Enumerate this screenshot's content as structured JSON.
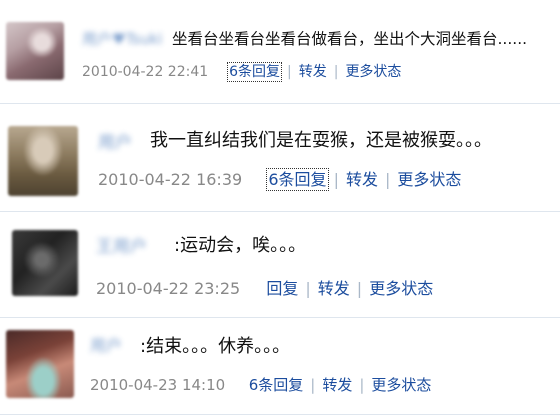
{
  "posts": [
    {
      "name": "用户♥Tsuki",
      "separator": ":",
      "text": "坐看台坐看台坐看台做看台，坐出个大洞坐看台......",
      "time": "2010-04-22 22:41",
      "reply": "6条回复",
      "forward": "转发",
      "more": "更多状态"
    },
    {
      "name": "用户",
      "separator": ":",
      "text": "我一直纠结我们是在耍猴，还是被猴耍。。。",
      "time": "2010-04-22 16:39",
      "reply": "6条回复",
      "forward": "转发",
      "more": "更多状态"
    },
    {
      "name": "王用户",
      "separator": ":",
      "text": "运动会，唉。。。",
      "time": "2010-04-22 23:25",
      "reply": "回复",
      "forward": "转发",
      "more": "更多状态"
    },
    {
      "name": "用户",
      "separator": ":",
      "text": "结束。。。休养。。。",
      "time": "2010-04-23 14:10",
      "reply": "6条回复",
      "forward": "转发",
      "more": "更多状态"
    }
  ],
  "colors": {
    "link": "#1c4d9e",
    "name": "#6f95c8",
    "time": "#888888",
    "text": "#111111",
    "divider": "#dfe6ee"
  },
  "icons": [
    "avatar-photo"
  ]
}
